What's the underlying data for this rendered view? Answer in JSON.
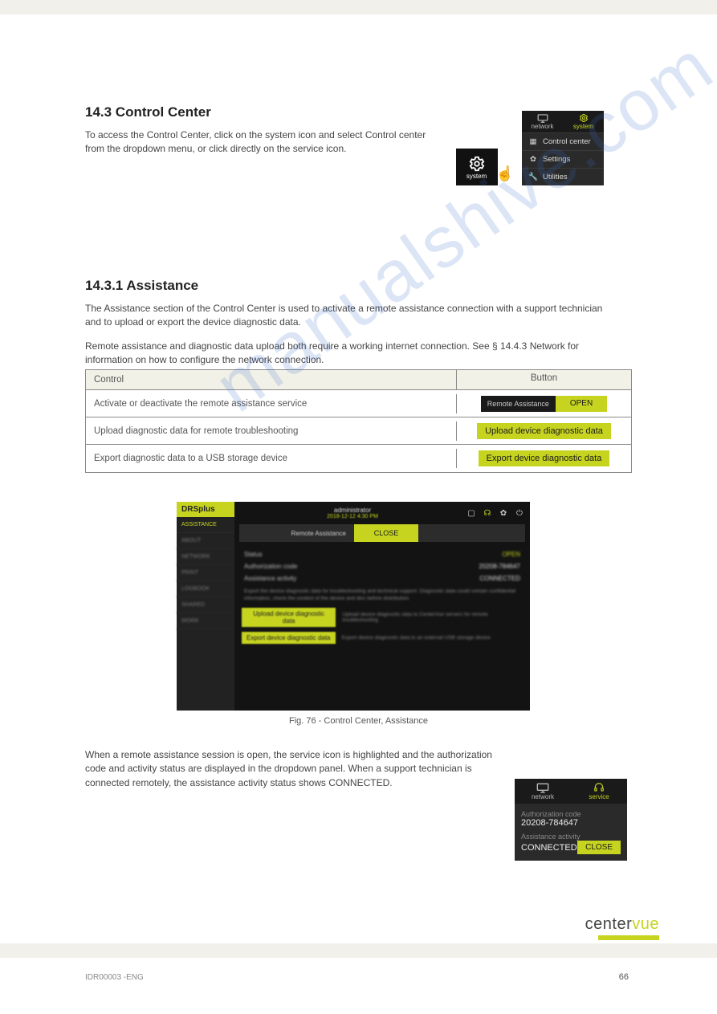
{
  "doc": {
    "code": "IDR00003 -ENG",
    "page": "66"
  },
  "logo": {
    "left": "center",
    "right": "vue"
  },
  "watermark": "manualshive.com",
  "sect1": {
    "heading": "14.3 Control Center",
    "text": "To access the Control Center, click on the system icon and select Control center from the dropdown menu, or click directly on the service icon."
  },
  "sysmenu": {
    "icon_label": "system",
    "tabs": [
      {
        "icon": "monitor",
        "label": "network"
      },
      {
        "icon": "gear",
        "label": "system"
      }
    ],
    "items": [
      {
        "icon": "grid",
        "label": "Control center"
      },
      {
        "icon": "gear",
        "label": "Settings"
      },
      {
        "icon": "wrench",
        "label": "Utilities"
      }
    ]
  },
  "sect2": {
    "heading": "14.3.1 Assistance",
    "p1": "The Assistance section of the Control Center is used to activate a remote assistance connection with a support technician and to upload or export the device diagnostic data.",
    "p2": "Remote assistance and diagnostic data upload both require a working internet connection. See § 14.4.3 Network for information on how to configure the network connection."
  },
  "table": {
    "head": {
      "c1": "Control",
      "c2": "Button"
    },
    "rows": [
      {
        "c1": "Activate or deactivate the remote assistance service",
        "btn_label": "Remote Assistance",
        "btn_action": "OPEN"
      },
      {
        "c1": "Upload diagnostic data for remote troubleshooting",
        "btn_action": "Upload device diagnostic data"
      },
      {
        "c1": "Export diagnostic data to a USB storage device",
        "btn_action": "Export device diagnostic data"
      }
    ]
  },
  "shot": {
    "app": "DRSplus",
    "user": "administrator",
    "date": "2018-12-12 4:30 PM",
    "nav": [
      "ASSISTANCE",
      "ABOUT",
      "NETWORK",
      "PRINT",
      "LOGBOOK",
      "SHARED",
      "WORK"
    ],
    "ra_label": "Remote Assistance",
    "ra_btn": "CLOSE",
    "kv": [
      {
        "k": "Status",
        "v": "OPEN",
        "cls": "green"
      },
      {
        "k": "Authorization code",
        "v": "20208-784647",
        "cls": "white"
      },
      {
        "k": "Assistance activity",
        "v": "CONNECTED",
        "cls": "white"
      }
    ],
    "desc": "Export the device diagnostic data for troubleshooting and technical support. Diagnostic data could contain confidential information, check the content of the device and disc before distribution.",
    "actions": [
      {
        "btn": "Upload device diagnostic data",
        "txt": "Upload device diagnostic data to CenterVue servers for remote troubleshooting"
      },
      {
        "btn": "Export device diagnostic data",
        "txt": "Export device diagnostic data to an external USB storage device"
      }
    ],
    "caption": "Fig. 76 - Control Center, Assistance",
    "icons": [
      "monitor",
      "headset",
      "gear",
      "power"
    ]
  },
  "sect3": {
    "p1": "When a remote assistance session is open, the service icon is highlighted and the authorization code and activity status are displayed in the dropdown panel. When a support technician is connected remotely, the assistance activity status shows CONNECTED."
  },
  "service_panel": {
    "tabs": [
      {
        "icon": "monitor",
        "label": "network"
      },
      {
        "icon": "headset",
        "label": "service"
      }
    ],
    "auth_label": "Authorization code",
    "auth_value": "20208-784647",
    "act_label": "Assistance activity",
    "act_value": "CONNECTED",
    "close_btn": "CLOSE"
  }
}
